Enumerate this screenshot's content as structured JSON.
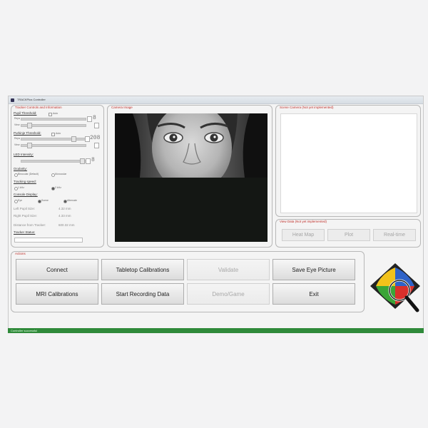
{
  "window": {
    "title": "TRACKPlus Controller"
  },
  "tracker_panel": {
    "title": "Tracker Controls and Information",
    "pupil_threshold": {
      "label": "Pupil Threshold:",
      "auto_label": "Auto",
      "value": "8",
      "row1_label": "Reps",
      "row2_label": "View"
    },
    "purkinje_threshold": {
      "label": "Purkinje Threshold:",
      "auto_label": "Auto",
      "value": "208",
      "row1_label": "Reps",
      "row2_label": "View"
    },
    "led_intensity": {
      "label": "LED Intensity:",
      "value": "8"
    },
    "ocularity": {
      "label": "Ocularity:",
      "options": [
        "Binocular (Default)",
        "Monocular"
      ]
    },
    "tracking_speed": {
      "label": "Tracking speed:",
      "options": [
        "1 kHz",
        "2 kHz"
      ]
    },
    "console_display": {
      "label": "Console Display:",
      "options": [
        "Eye",
        "Scene",
        "Alternate"
      ]
    },
    "left_pupil": {
      "label": "Left Pupil Size:",
      "value": "4.32 mm"
    },
    "right_pupil": {
      "label": "Right Pupil Size:",
      "value": "4.33 mm"
    },
    "distance": {
      "label": "Distance from Tracker:",
      "value": "600.32 mm"
    },
    "tracker_status": {
      "label": "Tracker Status:",
      "value": ""
    }
  },
  "camera_panel": {
    "title": "Camera Image"
  },
  "scene_panel": {
    "title": "Scene Camera (Not yet implemented)"
  },
  "view_panel": {
    "title": "View Data (Not yet implemented)",
    "buttons": [
      "Heat Map",
      "Plot",
      "Real-time"
    ]
  },
  "actions_panel": {
    "title": "Actions",
    "connect": "Connect",
    "tabletop": "Tabletop Calibrations",
    "validate": "Validate",
    "save_eye": "Save Eye Picture",
    "mri": "MRI Calibrations",
    "start_recording": "Start Recording Data",
    "demo": "Demo/Game",
    "exit": "Exit"
  },
  "status": {
    "text": "Controller successful"
  },
  "colors": {
    "accent_label": "#c0302a",
    "status_bar": "#2f8a3a",
    "logo_red": "#d9302b",
    "logo_green": "#3aa537",
    "logo_blue": "#2f63c8",
    "logo_yellow": "#f1c21b"
  },
  "logo": {
    "icon": "eye-magnifier-logo-icon"
  }
}
